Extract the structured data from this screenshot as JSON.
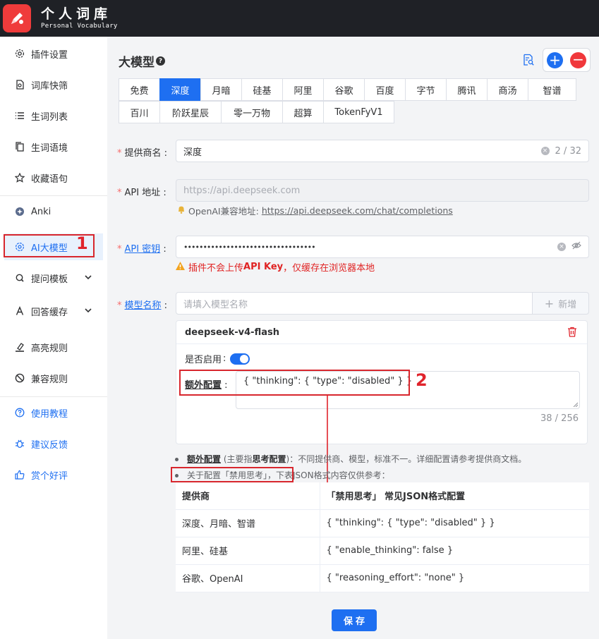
{
  "header": {
    "title": "个人词库",
    "subtitle": "Personal Vocabulary"
  },
  "sidebar": {
    "items": [
      {
        "label": "插件设置",
        "icon": "gear-icon"
      },
      {
        "label": "词库快筛",
        "icon": "document-search-icon"
      },
      {
        "label": "生词列表",
        "icon": "list-icon"
      },
      {
        "label": "生词语境",
        "icon": "copy-document-icon"
      },
      {
        "label": "收藏语句",
        "icon": "star-icon"
      },
      {
        "label": "Anki",
        "icon": "anki-icon"
      },
      {
        "label": "AI大模型",
        "icon": "openai-icon",
        "active": true
      },
      {
        "label": "提问模板",
        "icon": "question-icon"
      },
      {
        "label": "回答缓存",
        "icon": "letter-a-icon"
      },
      {
        "label": "高亮规则",
        "icon": "highlight-icon"
      },
      {
        "label": "兼容规则",
        "icon": "block-icon"
      },
      {
        "label": "使用教程",
        "icon": "help-circle-icon"
      },
      {
        "label": "建议反馈",
        "icon": "bug-icon"
      },
      {
        "label": "赏个好评",
        "icon": "thumbs-up-icon"
      }
    ]
  },
  "annotations": {
    "one": "1",
    "two": "2"
  },
  "main": {
    "title": "大模型",
    "tabs_row1": [
      "免费",
      "深度",
      "月暗",
      "硅基",
      "阿里",
      "谷歌",
      "百度",
      "字节",
      "腾讯",
      "商汤",
      "智谱"
    ],
    "tabs_row2": [
      "百川",
      "阶跃星辰",
      "零一万物",
      "超算",
      "TokenFyV1"
    ],
    "active_tab": "深度",
    "form": {
      "provider_label": "提供商名",
      "provider_value": "深度",
      "provider_count": "2 / 32",
      "api_url_label": "API 地址",
      "api_url_placeholder": "https://api.deepseek.com",
      "api_hint_prefix": "OpenAI兼容地址: ",
      "api_hint_link": "https://api.deepseek.com/chat/completions",
      "api_key_label_u": "API 密钥",
      "api_key_value": "••••••••••••••••••••••••••••••••••",
      "api_key_warn_1": "插件不会上传 ",
      "api_key_warn_bold": "API Key",
      "api_key_warn_2": "，仅缓存在浏览器本地",
      "model_label_u": "模型名称",
      "model_placeholder": "请填入模型名称",
      "add_button": "新增"
    },
    "model_card": {
      "name": "deepseek-v4-flash",
      "enabled_label": "是否启用",
      "extra_label": "额外配置",
      "extra_value": "{ \"thinking\": { \"type\": \"disabled\" } }",
      "counter": "38 / 256"
    },
    "notes": {
      "n1_bold": "额外配置",
      "n1_mid1": " (主要指",
      "n1_bold2": "思考配置",
      "n1_rest": ")：不同提供商、模型，标准不一。详细配置请参考提供商文档。",
      "n2_boxed": "关于配置「禁用思考」",
      "n2_rest": "，下表JSON格式内容仅供参考："
    },
    "table": {
      "headers": [
        "提供商",
        "「禁用思考」 常见JSON格式配置"
      ],
      "rows": [
        [
          "深度、月暗、智谱",
          "{ \"thinking\": { \"type\": \"disabled\" } }"
        ],
        [
          "阿里、硅基",
          "{ \"enable_thinking\": false }"
        ],
        [
          "谷歌、OpenAI",
          "{ \"reasoning_effort\": \"none\" }"
        ]
      ]
    },
    "save_button": "保存"
  },
  "colors": {
    "accent": "#1e6ff1",
    "danger": "#e0242c",
    "header_bg": "#1f2126"
  }
}
